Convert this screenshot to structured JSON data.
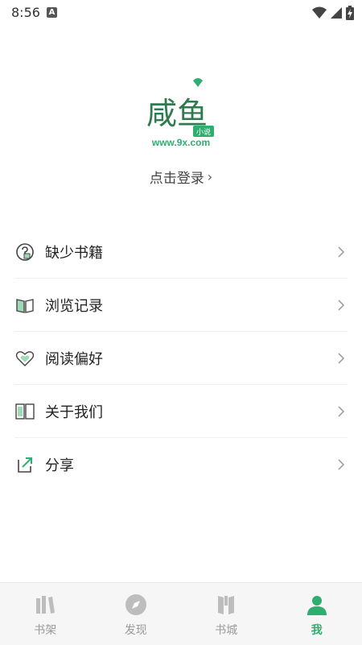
{
  "status_bar": {
    "time": "8:56",
    "notification_icon": "A"
  },
  "logo": {
    "brand_text": "咸鱼",
    "badge_text": "小说",
    "url": "www.9x.com"
  },
  "login": {
    "label": "点击登录",
    "chevron": "›"
  },
  "menu": [
    {
      "label": "缺少书籍",
      "icon": "question-book-icon"
    },
    {
      "label": "浏览记录",
      "icon": "open-book-icon"
    },
    {
      "label": "阅读偏好",
      "icon": "heart-icon"
    },
    {
      "label": "关于我们",
      "icon": "book-info-icon"
    },
    {
      "label": "分享",
      "icon": "share-icon"
    }
  ],
  "tabs": [
    {
      "label": "书架",
      "icon": "bookshelf-icon",
      "active": false
    },
    {
      "label": "发现",
      "icon": "compass-icon",
      "active": false
    },
    {
      "label": "书城",
      "icon": "bookstore-icon",
      "active": false
    },
    {
      "label": "我",
      "icon": "person-icon",
      "active": true
    }
  ],
  "colors": {
    "accent": "#2fae6f",
    "inactive": "#9a9a9a",
    "tabbar_bg": "#f6f6f6"
  }
}
